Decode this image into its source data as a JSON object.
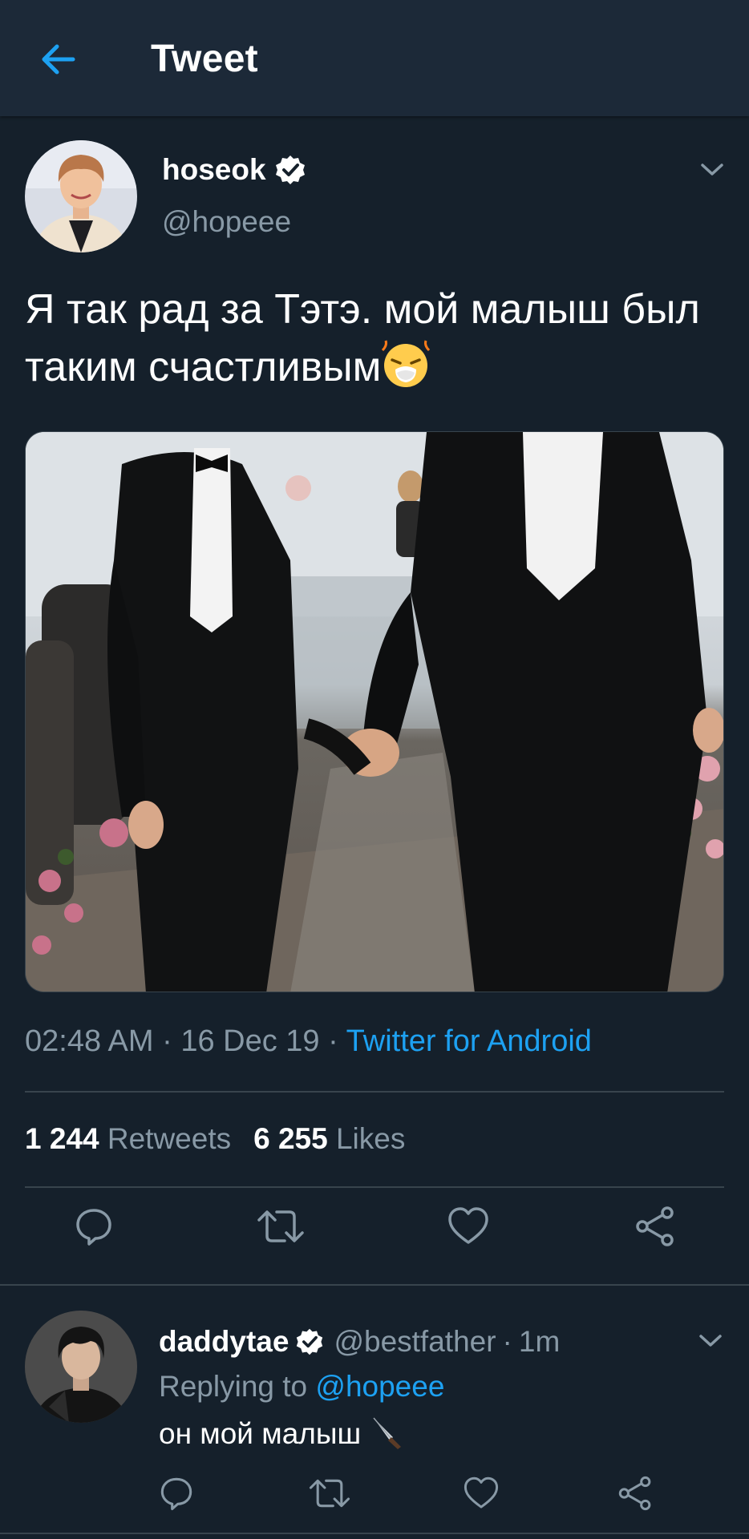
{
  "header": {
    "title": "Tweet",
    "back_icon": "arrow-left-icon"
  },
  "tweet": {
    "display_name": "hoseok",
    "handle": "@hopeee",
    "text": "Я так рад за Тэтэ. мой малыш был таким счастливым",
    "emoji": "face-with-steam-crying-icon",
    "time": "02:48 AM",
    "date": "16 Dec 19",
    "source": "Twitter for Android",
    "retweets_count": "1 244",
    "retweets_label": "Retweets",
    "likes_count": "6 255",
    "likes_label": "Likes",
    "media": "photo-two-men-in-tuxedos-holding-hands"
  },
  "reply": {
    "display_name": "daddytae",
    "handle": "@bestfather",
    "time": "1m",
    "replying_label": "Replying to",
    "replying_to": "@hopeee",
    "text": "он мой малыш",
    "emoji": "knife-icon"
  },
  "colors": {
    "background": "#15202b",
    "header": "#1c2938",
    "accent": "#1da1f2",
    "secondary_text": "#8899a6",
    "divider": "#38444d"
  }
}
